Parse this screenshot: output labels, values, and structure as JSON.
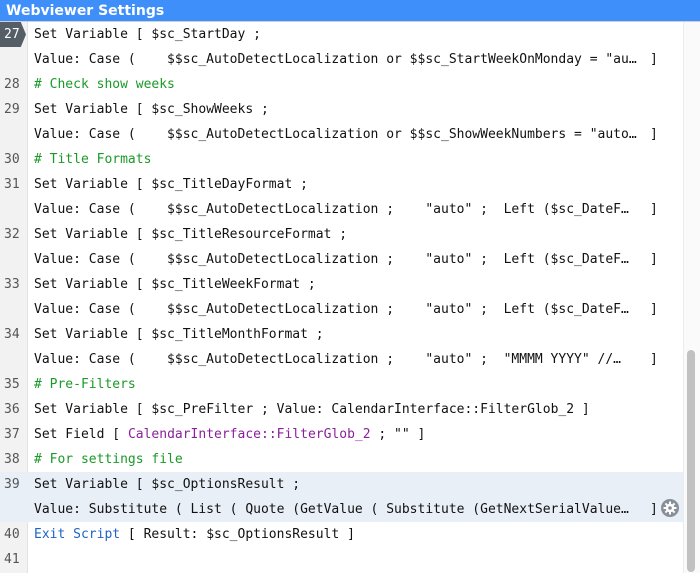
{
  "window": {
    "title": "Webviewer Settings"
  },
  "lines": [
    {
      "num": "27",
      "current": true,
      "segments": [
        {
          "t": "Set Variable ",
          "c": "plain"
        },
        {
          "t": "[ $sc_StartDay ;",
          "c": "plain"
        }
      ]
    },
    {
      "num": "",
      "segments": [
        {
          "t": "Value: Case (    $$sc_AutoDetectLocalization or $$sc_StartWeekOnMonday = \"au…",
          "c": "plain"
        }
      ],
      "end": "]"
    },
    {
      "num": "28",
      "segments": [
        {
          "t": "# Check show weeks",
          "c": "cmt"
        }
      ]
    },
    {
      "num": "29",
      "segments": [
        {
          "t": "Set Variable ",
          "c": "plain"
        },
        {
          "t": "[ $sc_ShowWeeks ;",
          "c": "plain"
        }
      ]
    },
    {
      "num": "",
      "segments": [
        {
          "t": "Value: Case (    $$sc_AutoDetectLocalization or $$sc_ShowWeekNumbers = \"auto…",
          "c": "plain"
        }
      ],
      "end": "]"
    },
    {
      "num": "30",
      "segments": [
        {
          "t": "# Title Formats",
          "c": "cmt"
        }
      ]
    },
    {
      "num": "31",
      "segments": [
        {
          "t": "Set Variable ",
          "c": "plain"
        },
        {
          "t": "[ $sc_TitleDayFormat ;",
          "c": "plain"
        }
      ]
    },
    {
      "num": "",
      "segments": [
        {
          "t": "Value: Case (    $$sc_AutoDetectLocalization ;    \"auto\" ;  Left ($sc_DateF…",
          "c": "plain"
        }
      ],
      "end": "]"
    },
    {
      "num": "32",
      "segments": [
        {
          "t": "Set Variable ",
          "c": "plain"
        },
        {
          "t": "[ $sc_TitleResourceFormat ;",
          "c": "plain"
        }
      ]
    },
    {
      "num": "",
      "segments": [
        {
          "t": "Value: Case (    $$sc_AutoDetectLocalization ;    \"auto\" ;  Left ($sc_DateF…",
          "c": "plain"
        }
      ],
      "end": "]"
    },
    {
      "num": "33",
      "segments": [
        {
          "t": "Set Variable ",
          "c": "plain"
        },
        {
          "t": "[ $sc_TitleWeekFormat ;",
          "c": "plain"
        }
      ]
    },
    {
      "num": "",
      "segments": [
        {
          "t": "Value: Case (    $$sc_AutoDetectLocalization ;    \"auto\" ;  Left ($sc_DateF…",
          "c": "plain"
        }
      ],
      "end": "]"
    },
    {
      "num": "34",
      "segments": [
        {
          "t": "Set Variable ",
          "c": "plain"
        },
        {
          "t": "[ $sc_TitleMonthFormat ;",
          "c": "plain"
        }
      ]
    },
    {
      "num": "",
      "segments": [
        {
          "t": "Value: Case (    $$sc_AutoDetectLocalization ;    \"auto\" ;  \"MMMM YYYY\" //…",
          "c": "plain"
        }
      ],
      "end": "]"
    },
    {
      "num": "35",
      "segments": [
        {
          "t": "# Pre-Filters",
          "c": "cmt"
        }
      ]
    },
    {
      "num": "36",
      "segments": [
        {
          "t": "Set Variable ",
          "c": "plain"
        },
        {
          "t": "[ $sc_PreFilter ; Value: CalendarInterface::FilterGlob_2 ]",
          "c": "plain"
        }
      ]
    },
    {
      "num": "37",
      "segments": [
        {
          "t": "Set Field ",
          "c": "plain"
        },
        {
          "t": "[ ",
          "c": "plain"
        },
        {
          "t": "CalendarInterface::FilterGlob_2",
          "c": "fld"
        },
        {
          "t": " ; \"\" ]",
          "c": "plain"
        }
      ]
    },
    {
      "num": "38",
      "segments": [
        {
          "t": "# For settings file",
          "c": "cmt"
        }
      ]
    },
    {
      "num": "39",
      "selected": true,
      "segments": [
        {
          "t": "Set Variable ",
          "c": "plain"
        },
        {
          "t": "[ $sc_OptionsResult ;",
          "c": "plain"
        }
      ]
    },
    {
      "num": "",
      "selected": true,
      "segments": [
        {
          "t": "Value: Substitute ( List ( Quote (GetValue ( Substitute (GetNextSerialValue…",
          "c": "plain"
        }
      ],
      "end": "]"
    },
    {
      "num": "40",
      "segments": [
        {
          "t": "Exit Script ",
          "c": "kw"
        },
        {
          "t": "[ Result: $sc_OptionsResult ]",
          "c": "plain"
        }
      ]
    },
    {
      "num": "41",
      "segments": []
    }
  ],
  "icons": {
    "gear": "gear-icon"
  },
  "colors": {
    "titlebar": "#3f8ffb",
    "comment": "#1a9a28",
    "field": "#8b1f9c",
    "keyword": "#1f63c9",
    "selection": "#e9eff7"
  }
}
